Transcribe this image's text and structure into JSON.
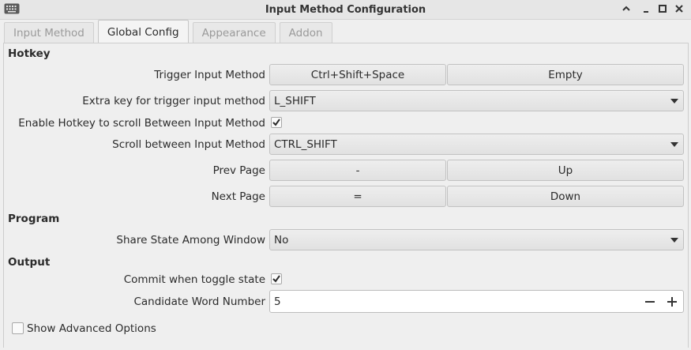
{
  "window": {
    "title": "Input Method Configuration",
    "app_icon": "keyboard-icon",
    "controls": [
      "chevron-up-icon",
      "minimize-icon",
      "maximize-icon",
      "close-icon"
    ]
  },
  "tabs": [
    {
      "label": "Input Method",
      "active": false
    },
    {
      "label": "Global Config",
      "active": true
    },
    {
      "label": "Appearance",
      "active": false
    },
    {
      "label": "Addon",
      "active": false
    }
  ],
  "hotkey": {
    "section": "Hotkey",
    "trigger": {
      "label": "Trigger Input Method",
      "key1": "Ctrl+Shift+Space",
      "key2": "Empty"
    },
    "extra_key": {
      "label": "Extra key for trigger input method",
      "value": "L_SHIFT"
    },
    "enable_scroll": {
      "label": "Enable Hotkey to scroll Between Input Method",
      "checked": true
    },
    "scroll": {
      "label": "Scroll between Input Method",
      "value": "CTRL_SHIFT"
    },
    "prev_page": {
      "label": "Prev Page",
      "key1": "-",
      "key2": "Up"
    },
    "next_page": {
      "label": "Next Page",
      "key1": "=",
      "key2": "Down"
    }
  },
  "program": {
    "section": "Program",
    "share_state": {
      "label": "Share State Among Window",
      "value": "No"
    }
  },
  "output": {
    "section": "Output",
    "commit_toggle": {
      "label": "Commit when toggle state",
      "checked": true
    },
    "candidate": {
      "label": "Candidate Word Number",
      "value": "5"
    }
  },
  "advanced": {
    "label": "Show Advanced Options",
    "checked": false
  },
  "icons": {
    "decrement": "minus-icon",
    "increment": "plus-icon",
    "dropdown": "chevron-down-icon",
    "check": "checkmark-icon"
  }
}
